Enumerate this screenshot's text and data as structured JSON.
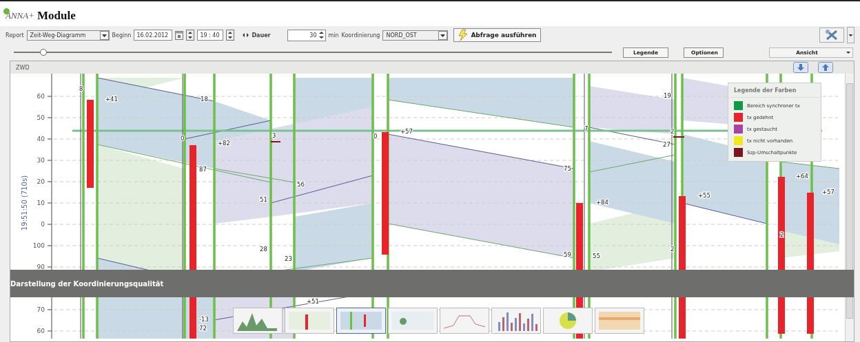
{
  "header": {
    "brand": "ANNA+",
    "title": "Module"
  },
  "toolbar": {
    "report_label": "Report",
    "report_value": "Zeit-Weg-Diagramm",
    "begin_label": "Beginn",
    "date": "16.02.2012",
    "time": "19 : 40",
    "duration_label": "Dauer",
    "duration": "30",
    "unit": "min",
    "coordination_label": "Koordinierung",
    "coordination_value": "NORD_OST",
    "run_button": "Abfrage ausführen"
  },
  "controls": {
    "slider": {
      "level": 0.05
    },
    "buttons": [
      "Legende",
      "Optionen"
    ],
    "view_select": "Ansicht"
  },
  "panel": {
    "title": "ZWD",
    "y_axis": {
      "label": "19:51:50 (710s)",
      "ticks": [
        "60",
        "50",
        "40",
        "30",
        "20",
        "10",
        "0",
        "100",
        "90",
        "70",
        "60"
      ]
    },
    "labels": [
      "8",
      "+41",
      "18",
      "0",
      "+82",
      "87",
      "3",
      "56",
      "51",
      "28",
      "23",
      "0",
      "+57",
      "75",
      "+84",
      "59",
      "55",
      "7",
      "19",
      "2",
      "27",
      "+55",
      "2",
      "2",
      "+64",
      "+57",
      "-13",
      "72",
      "+51"
    ],
    "legend": {
      "title": "Legende der Farben",
      "items": [
        {
          "label": "Bereich synchroner tx",
          "color": "#0f9a48"
        },
        {
          "label": "tx gedehnt",
          "color": "#e8232a"
        },
        {
          "label": "tx gestaucht",
          "color": "#a8449c"
        },
        {
          "label": "tx nicht vorhanden",
          "color": "#f2e81c"
        },
        {
          "label": "Szp-Umschaltpunkte",
          "color": "#7d1420"
        }
      ]
    }
  },
  "caption": "Darstellung der Koordinierungsqualität",
  "thumbnails": [
    {
      "kind": "area"
    },
    {
      "kind": "table"
    },
    {
      "kind": "diagram"
    },
    {
      "kind": "map"
    },
    {
      "kind": "line"
    },
    {
      "kind": "bars"
    },
    {
      "kind": "pie"
    },
    {
      "kind": "grid"
    }
  ]
}
